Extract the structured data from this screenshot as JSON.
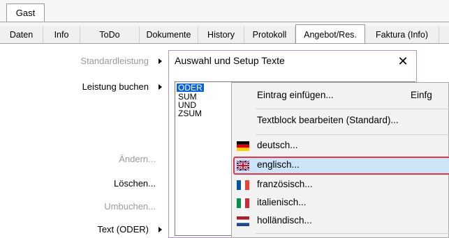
{
  "header": {
    "gast_tab": "Gast"
  },
  "tabs": [
    "Daten",
    "Info",
    "ToDo",
    "Dokumente",
    "History",
    "Protokoll",
    "Angebot/Res.",
    "Faktura (Info)"
  ],
  "left_menu": {
    "standardleistung": "Standardleistung",
    "leistung_buchen": "Leistung buchen",
    "aendern": "Ändern...",
    "loeschen": "Löschen...",
    "umbuchen": "Umbuchen...",
    "text_oder": "Text (ODER)"
  },
  "dialog": {
    "title": "Auswahl und Setup Texte",
    "close": "✕",
    "list": [
      "ODER",
      "SUM",
      "UND",
      "ZSUM"
    ]
  },
  "context_menu": {
    "eintrag": {
      "label": "Eintrag einfügen...",
      "shortcut": "Einfg"
    },
    "textblock": "Textblock bearbeiten (Standard)...",
    "languages": [
      {
        "label": "deutsch...",
        "flag": "de"
      },
      {
        "label": "englisch...",
        "flag": "gb"
      },
      {
        "label": "französisch...",
        "flag": "fr"
      },
      {
        "label": "italienisch...",
        "flag": "it"
      },
      {
        "label": "holländisch...",
        "flag": "nl"
      }
    ]
  },
  "colors": {
    "selection": "#0a64d8",
    "highlight": "#cce4f7",
    "annotation": "#e0354a",
    "dialog_border": "#b48fd1"
  }
}
